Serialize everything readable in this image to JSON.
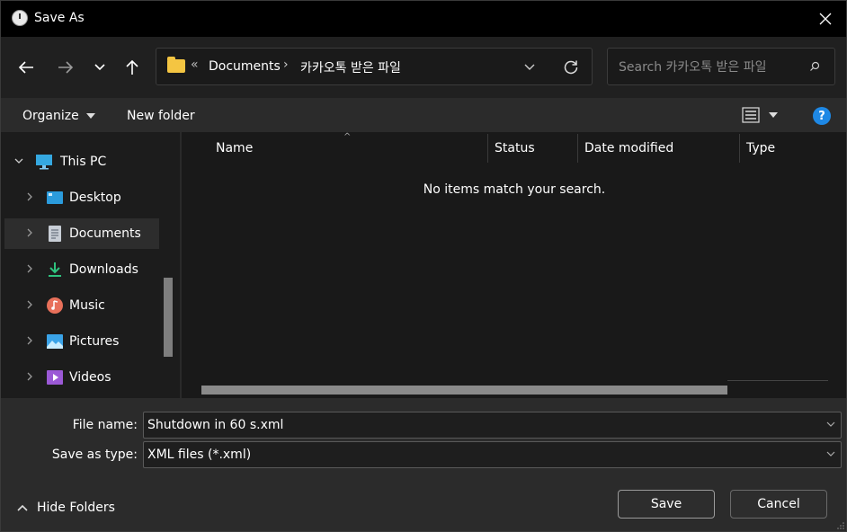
{
  "window": {
    "title": "Save As"
  },
  "address": {
    "overflow_glyph": "«",
    "crumbs": [
      "Documents",
      "카카오톡 받은 파일"
    ],
    "separator": "›"
  },
  "search": {
    "placeholder": "Search 카카오톡 받은 파일"
  },
  "toolbar": {
    "organize_label": "Organize",
    "new_folder_label": "New folder",
    "help_label": "?"
  },
  "nav": {
    "items": [
      {
        "label": "This PC",
        "icon": "computer-icon"
      },
      {
        "label": "Desktop",
        "icon": "desktop-icon"
      },
      {
        "label": "Documents",
        "icon": "documents-icon",
        "selected": true
      },
      {
        "label": "Downloads",
        "icon": "downloads-icon"
      },
      {
        "label": "Music",
        "icon": "music-icon"
      },
      {
        "label": "Pictures",
        "icon": "pictures-icon"
      },
      {
        "label": "Videos",
        "icon": "videos-icon"
      }
    ]
  },
  "content": {
    "columns": [
      "Name",
      "Status",
      "Date modified",
      "Type"
    ],
    "empty_message": "No items match your search."
  },
  "form": {
    "file_name_label": "File name:",
    "file_name_value": "Shutdown in 60 s.xml",
    "save_as_type_label": "Save as type:",
    "save_as_type_value": "XML files (*.xml)"
  },
  "footer": {
    "hide_folders_label": "Hide Folders",
    "save_label": "Save",
    "cancel_label": "Cancel"
  },
  "colors": {
    "accent": "#1e88e5",
    "folder": "#f4c542",
    "background": "#202020"
  }
}
